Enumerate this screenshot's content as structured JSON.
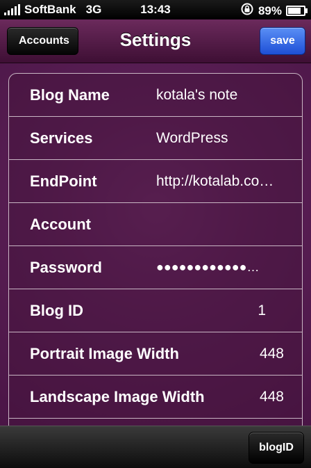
{
  "status_bar": {
    "carrier": "SoftBank",
    "network": "3G",
    "time": "13:43",
    "battery": "89%",
    "battery_level": 0.89
  },
  "nav": {
    "title": "Settings",
    "back_label": "Accounts",
    "save_label": "save"
  },
  "rows": [
    {
      "label": "Blog Name",
      "value": "kotala's note"
    },
    {
      "label": "Services",
      "value": "WordPress"
    },
    {
      "label": "EndPoint",
      "value": "http://kotalab.co…"
    },
    {
      "label": "Account",
      "value": ""
    },
    {
      "label": "Password",
      "value": "●●●●●●●●●●●●…"
    },
    {
      "label": "Blog ID",
      "value": "1"
    },
    {
      "label": "Portrait Image Width",
      "value": "448"
    },
    {
      "label": "Landscape Image Width",
      "value": "448"
    }
  ],
  "toolbar": {
    "blogid_label": "blogID"
  },
  "colors": {
    "nav_bg": "#5a1f4e",
    "save_blue": "#2f63e6",
    "content_bg": "#5a1f55"
  }
}
